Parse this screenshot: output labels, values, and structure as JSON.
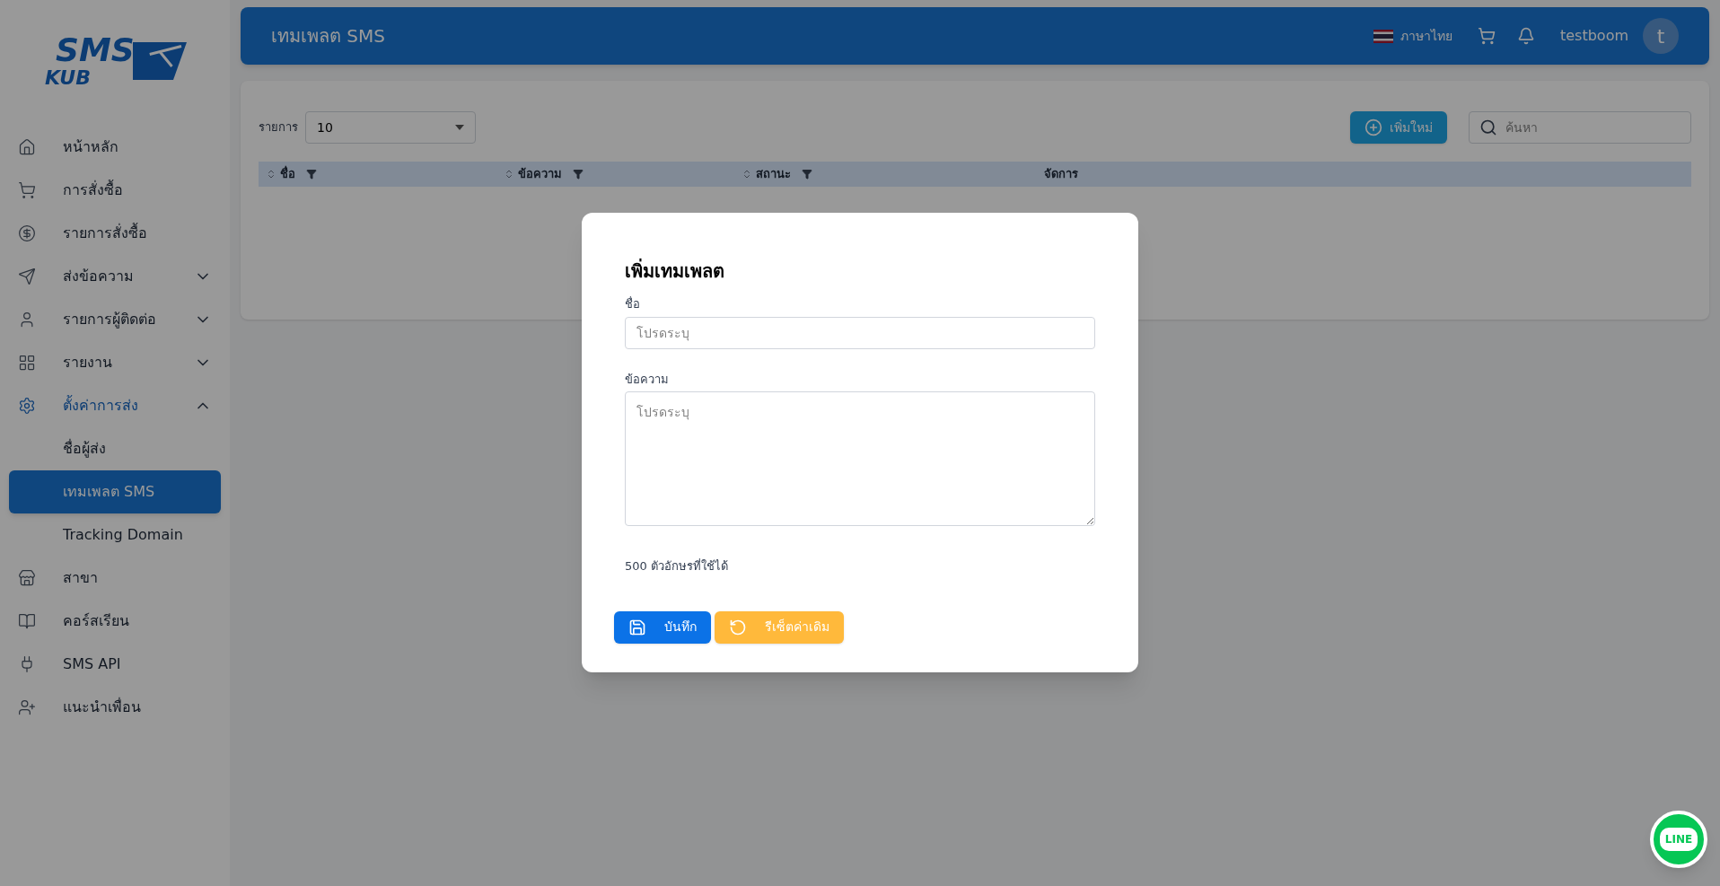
{
  "logo": {
    "line1": "SMS",
    "line2": "KUB"
  },
  "sidebar": {
    "items": [
      {
        "label": "หน้าหลัก",
        "selected": false
      },
      {
        "label": "การสั่งซื้อ",
        "selected": false
      },
      {
        "label": "รายการสั่งซื้อ",
        "selected": false
      },
      {
        "label": "ส่งข้อความ",
        "selected": false,
        "expanded": false
      },
      {
        "label": "รายการผู้ติดต่อ",
        "selected": false,
        "expanded": false
      },
      {
        "label": "รายงาน",
        "selected": false,
        "expanded": false
      },
      {
        "label": "ตั้งค่าการส่ง",
        "selected": true,
        "expanded": true,
        "children": [
          {
            "label": "ชื่อผู้ส่ง",
            "selected": false
          },
          {
            "label": "เทมเพลต SMS",
            "selected": true
          },
          {
            "label": "Tracking Domain",
            "selected": false
          }
        ]
      },
      {
        "label": "สาขา",
        "selected": false
      },
      {
        "label": "คอร์สเรียน",
        "selected": false
      },
      {
        "label": "SMS API",
        "selected": false
      },
      {
        "label": "แนะนำเพื่อน",
        "selected": false
      }
    ]
  },
  "header": {
    "title": "เทมเพลต SMS",
    "language": "ภาษาไทย",
    "username": "testboom",
    "avatar_letter": "t"
  },
  "toolbar": {
    "rows_label": "รายการ",
    "rows_value": "10",
    "add_button": "เพิ่มใหม่",
    "search": {
      "placeholder": "ค้นหา"
    }
  },
  "table": {
    "columns": [
      {
        "label": "ชื่อ",
        "sortable": true,
        "filterable": true
      },
      {
        "label": "ข้อความ",
        "sortable": true,
        "filterable": true
      },
      {
        "label": "สถานะ",
        "sortable": true,
        "filterable": true
      },
      {
        "label": "จัดการ",
        "sortable": false,
        "filterable": false
      }
    ]
  },
  "modal": {
    "title": "เพิ่มเทมเพลต",
    "fields": [
      {
        "kind": "input",
        "label": "ชื่อ",
        "placeholder": "โปรดระบุ"
      },
      {
        "kind": "textarea",
        "label": "ข้อความ",
        "placeholder": "โปรดระบุ"
      }
    ],
    "counter": "500 ตัวอักษรที่ใช้ได้",
    "buttons": [
      {
        "kind": "save",
        "label": "บันทึก"
      },
      {
        "kind": "reset",
        "label": "รีเซ็ตค่าเดิม"
      }
    ]
  },
  "line_button": {
    "label": "LINE"
  }
}
